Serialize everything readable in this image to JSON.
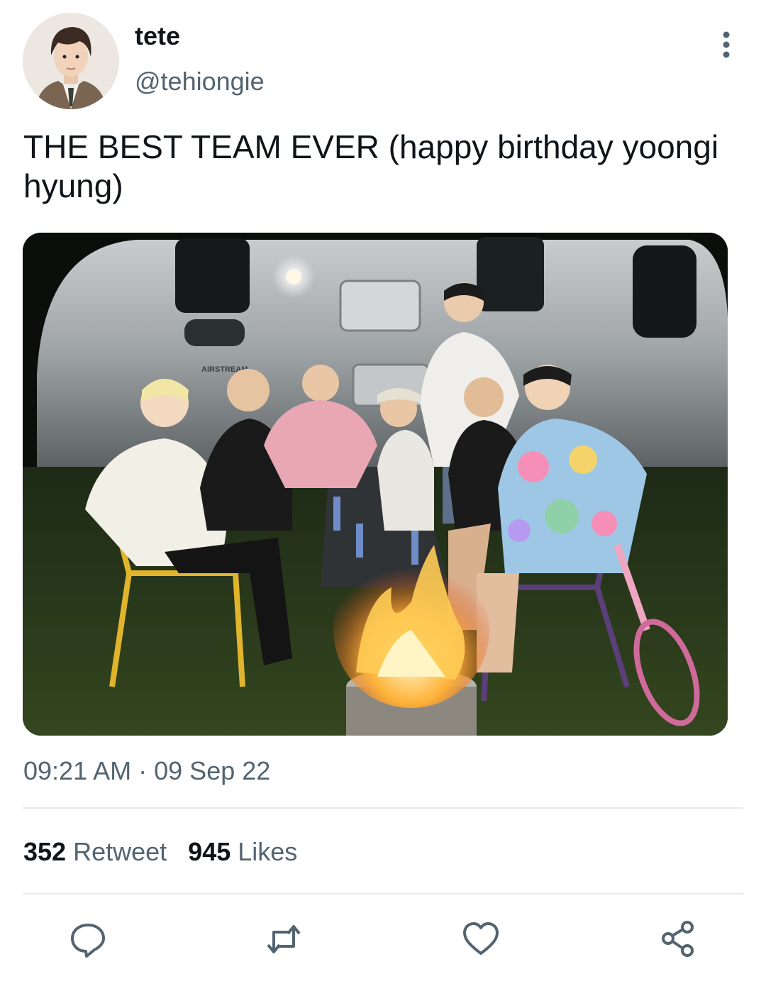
{
  "author": {
    "display_name": "tete",
    "handle": "@tehiongie"
  },
  "tweet": {
    "text": "THE BEST TEAM EVER (happy birthday yoongi hyung)",
    "time": "09:21 AM",
    "separator": "·",
    "date": "09 Sep 22"
  },
  "stats": {
    "retweet_count": "352",
    "retweet_label": "Retweet",
    "likes_count": "945",
    "likes_label": "Likes"
  },
  "actions": [
    "reply-icon",
    "retweet-icon",
    "like-icon",
    "share-icon"
  ],
  "icons": {
    "more": "more-vertical-icon"
  },
  "colors": {
    "primary_text": "#0f1419",
    "secondary_text": "#536471",
    "icon": "#536471",
    "divider": "#e7e9ea"
  }
}
